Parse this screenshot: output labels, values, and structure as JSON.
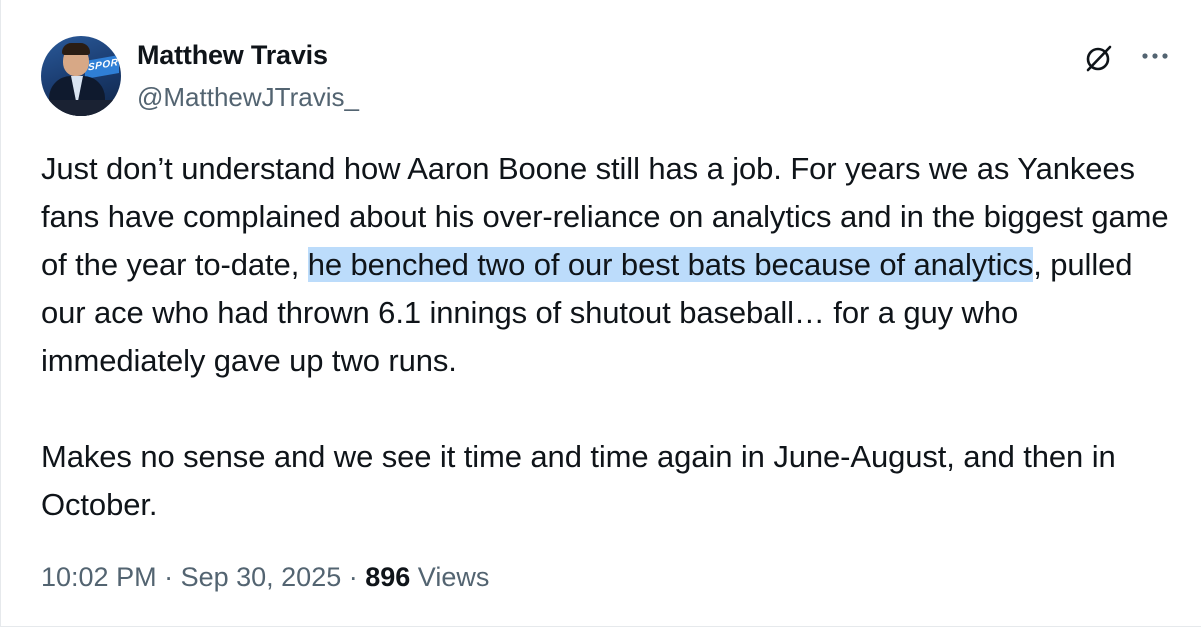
{
  "author": {
    "name": "Matthew Travis",
    "handle": "@MatthewJTravis_",
    "avatar_screen_text": "SPORTS"
  },
  "icons": {
    "grok": "grok-icon",
    "more": "more-options-icon"
  },
  "tweet": {
    "p1_before": "Just don’t understand how Aaron Boone still has a job. For years we as Yankees fans have complained about his over-reliance on analytics and in the biggest game of the year to-date, ",
    "p1_highlight": "he benched two of our best bats because of analytics",
    "p1_after": ", pulled our ace who had thrown 6.1 innings of shutout baseball… for a guy who immediately gave up two runs.",
    "p2": "Makes no sense and we see it time and time again in June-August, and then in October."
  },
  "meta": {
    "time": "10:02 PM",
    "sep1": " · ",
    "date": "Sep 30, 2025",
    "sep2": " · ",
    "views_count": "896",
    "views_label": " Views"
  },
  "colors": {
    "text": "#0f1419",
    "secondary": "#536471",
    "selection": "#bcdcfb"
  }
}
